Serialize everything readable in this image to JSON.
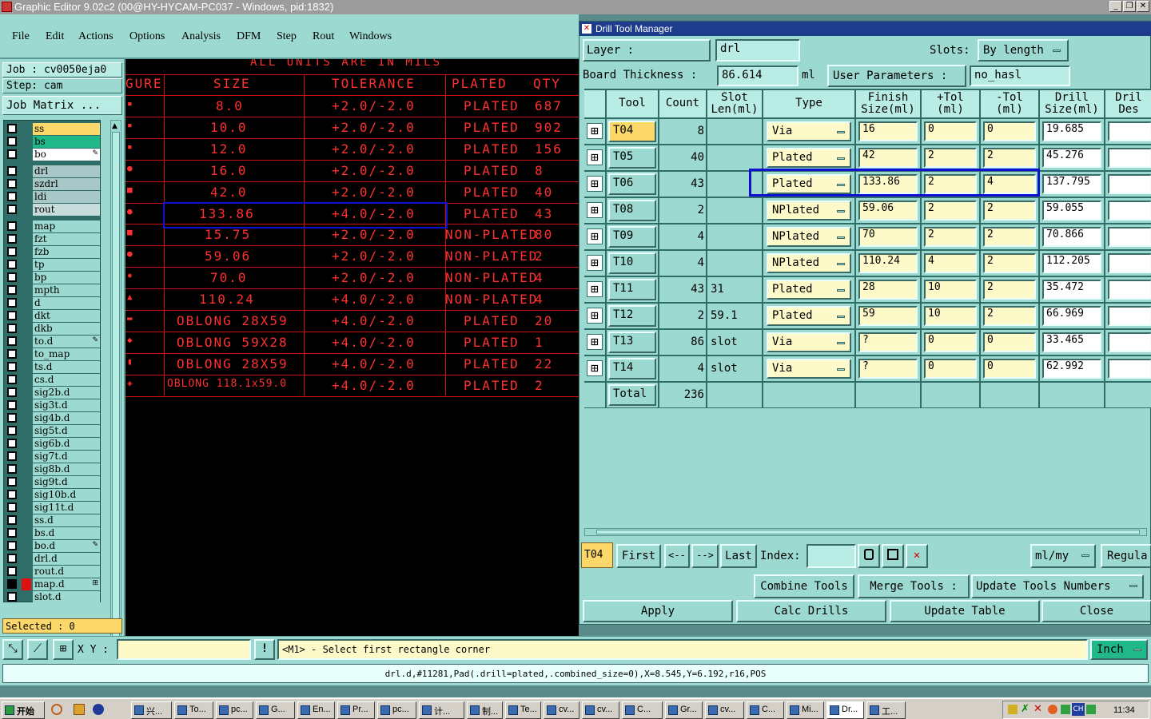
{
  "titlebar": {
    "title": "Graphic Editor 9.02c2 (00@HY-HYCAM-PC037 - Windows, pid:1832)"
  },
  "menu": [
    "File",
    "Edit",
    "Actions",
    "Options",
    "Analysis",
    "DFM",
    "Step",
    "Rout",
    "Windows"
  ],
  "left": {
    "job": "Job : cv0050eja0",
    "step": "Step: cam",
    "job_matrix": "Job Matrix ...",
    "selected": "Selected : 0",
    "layers": [
      {
        "name": "ss",
        "color": "#fcd86a",
        "tag": ""
      },
      {
        "name": "bs",
        "color": "#20b888",
        "tag": ""
      },
      {
        "name": "bo",
        "color": "#ffffff",
        "tag": "✎"
      },
      {
        "name": "drl",
        "color": "#a8c8c8",
        "tag": ""
      },
      {
        "name": "szdrl",
        "color": "#a8c8c8",
        "tag": ""
      },
      {
        "name": "ldi",
        "color": "#a8c8c8",
        "tag": ""
      },
      {
        "name": "rout",
        "color": "#c8dcdc",
        "tag": ""
      },
      {
        "name": "map",
        "color": "#9cd9d0",
        "tag": ""
      },
      {
        "name": "fzt",
        "color": "#9cd9d0",
        "tag": ""
      },
      {
        "name": "fzb",
        "color": "#9cd9d0",
        "tag": ""
      },
      {
        "name": "tp",
        "color": "#9cd9d0",
        "tag": ""
      },
      {
        "name": "bp",
        "color": "#9cd9d0",
        "tag": ""
      },
      {
        "name": "mpth",
        "color": "#9cd9d0",
        "tag": ""
      },
      {
        "name": "d",
        "color": "#9cd9d0",
        "tag": ""
      },
      {
        "name": "dkt",
        "color": "#9cd9d0",
        "tag": ""
      },
      {
        "name": "dkb",
        "color": "#9cd9d0",
        "tag": ""
      },
      {
        "name": "to.d",
        "color": "#9cd9d0",
        "tag": "✎"
      },
      {
        "name": "to_map",
        "color": "#9cd9d0",
        "tag": ""
      },
      {
        "name": "ts.d",
        "color": "#9cd9d0",
        "tag": ""
      },
      {
        "name": "cs.d",
        "color": "#9cd9d0",
        "tag": ""
      },
      {
        "name": "sig2b.d",
        "color": "#9cd9d0",
        "tag": ""
      },
      {
        "name": "sig3t.d",
        "color": "#9cd9d0",
        "tag": ""
      },
      {
        "name": "sig4b.d",
        "color": "#9cd9d0",
        "tag": ""
      },
      {
        "name": "sig5t.d",
        "color": "#9cd9d0",
        "tag": ""
      },
      {
        "name": "sig6b.d",
        "color": "#9cd9d0",
        "tag": ""
      },
      {
        "name": "sig7t.d",
        "color": "#9cd9d0",
        "tag": ""
      },
      {
        "name": "sig8b.d",
        "color": "#9cd9d0",
        "tag": ""
      },
      {
        "name": "sig9t.d",
        "color": "#9cd9d0",
        "tag": ""
      },
      {
        "name": "sig10b.d",
        "color": "#9cd9d0",
        "tag": ""
      },
      {
        "name": "sig11t.d",
        "color": "#9cd9d0",
        "tag": ""
      },
      {
        "name": "ss.d",
        "color": "#9cd9d0",
        "tag": ""
      },
      {
        "name": "bs.d",
        "color": "#9cd9d0",
        "tag": ""
      },
      {
        "name": "bo.d",
        "color": "#9cd9d0",
        "tag": "✎"
      },
      {
        "name": "drl.d",
        "color": "#9cd9d0",
        "tag": ""
      },
      {
        "name": "rout.d",
        "color": "#9cd9d0",
        "tag": ""
      },
      {
        "name": "map.d",
        "color": "#9cd9d0",
        "tag": "⊞"
      },
      {
        "name": "slot.d",
        "color": "#9cd9d0",
        "tag": ""
      }
    ]
  },
  "canvas": {
    "banner": "ALL UNITS ARE IN MILS",
    "headers": [
      "GURE",
      "SIZE",
      "TOLERANCE",
      "PLATED",
      "QTY"
    ],
    "rows": [
      {
        "size": "8.0",
        "tol": "+2.0/-2.0",
        "plated": "PLATED",
        "qty": "687",
        "sym": "▪"
      },
      {
        "size": "10.0",
        "tol": "+2.0/-2.0",
        "plated": "PLATED",
        "qty": "902",
        "sym": "▪"
      },
      {
        "size": "12.0",
        "tol": "+2.0/-2.0",
        "plated": "PLATED",
        "qty": "156",
        "sym": "▪"
      },
      {
        "size": "16.0",
        "tol": "+2.0/-2.0",
        "plated": "PLATED",
        "qty": "8",
        "sym": "●"
      },
      {
        "size": "42.0",
        "tol": "+2.0/-2.0",
        "plated": "PLATED",
        "qty": "40",
        "sym": "■"
      },
      {
        "size": "133.86",
        "tol": "+4.0/-2.0",
        "plated": "PLATED",
        "qty": "43",
        "sym": "●"
      },
      {
        "size": "15.75",
        "tol": "+2.0/-2.0",
        "plated": "NON-PLATED",
        "qty": "80",
        "sym": "■"
      },
      {
        "size": "59.06",
        "tol": "+2.0/-2.0",
        "plated": "NON-PLATED",
        "qty": "2",
        "sym": "●"
      },
      {
        "size": "70.0",
        "tol": "+2.0/-2.0",
        "plated": "NON-PLATED",
        "qty": "4",
        "sym": "✹"
      },
      {
        "size": "110.24",
        "tol": "+4.0/-2.0",
        "plated": "NON-PLATED",
        "qty": "4",
        "sym": "▲"
      },
      {
        "size": "OBLONG 28X59",
        "tol": "+4.0/-2.0",
        "plated": "PLATED",
        "qty": "20",
        "sym": "▬"
      },
      {
        "size": "OBLONG 59X28",
        "tol": "+4.0/-2.0",
        "plated": "PLATED",
        "qty": "1",
        "sym": "◆"
      },
      {
        "size": "OBLONG 28X59",
        "tol": "+4.0/-2.0",
        "plated": "PLATED",
        "qty": "22",
        "sym": "▮"
      },
      {
        "size": "OBLONG 118.1x59.0",
        "tol": "+4.0/-2.0",
        "plated": "PLATED",
        "qty": "2",
        "sym": "◈"
      }
    ]
  },
  "dialog": {
    "title": "Drill Tool Manager",
    "layer_label": "Layer          :",
    "layer_value": "drl",
    "slots_label": "Slots:",
    "slots_value": "By length",
    "board_thickness_label": "Board Thickness :",
    "board_thickness_value": "86.614",
    "board_thickness_unit": "ml",
    "user_params_label": "User Parameters :",
    "user_params_value": "no_hasl",
    "columns": [
      "Tool",
      "Count",
      "Slot Len(ml)",
      "Type",
      "Finish Size(ml)",
      "+Tol (ml)",
      "-Tol (ml)",
      "Drill Size(ml)",
      "Dril Des"
    ],
    "tools": [
      {
        "tool": "T04",
        "count": "8",
        "slot": "",
        "type": "Via",
        "finish": "16",
        "ptol": "0",
        "mtol": "0",
        "drill": "19.685"
      },
      {
        "tool": "T05",
        "count": "40",
        "slot": "",
        "type": "Plated",
        "finish": "42",
        "ptol": "2",
        "mtol": "2",
        "drill": "45.276"
      },
      {
        "tool": "T06",
        "count": "43",
        "slot": "",
        "type": "Plated",
        "finish": "133.86",
        "ptol": "2",
        "mtol": "4",
        "drill": "137.795"
      },
      {
        "tool": "T08",
        "count": "2",
        "slot": "",
        "type": "NPlated",
        "finish": "59.06",
        "ptol": "2",
        "mtol": "2",
        "drill": "59.055"
      },
      {
        "tool": "T09",
        "count": "4",
        "slot": "",
        "type": "NPlated",
        "finish": "70",
        "ptol": "2",
        "mtol": "2",
        "drill": "70.866"
      },
      {
        "tool": "T10",
        "count": "4",
        "slot": "",
        "type": "NPlated",
        "finish": "110.24",
        "ptol": "4",
        "mtol": "2",
        "drill": "112.205"
      },
      {
        "tool": "T11",
        "count": "43",
        "slot": "31",
        "type": "Plated",
        "finish": "28",
        "ptol": "10",
        "mtol": "2",
        "drill": "35.472"
      },
      {
        "tool": "T12",
        "count": "2",
        "slot": "59.1",
        "type": "Plated",
        "finish": "59",
        "ptol": "10",
        "mtol": "2",
        "drill": "66.969"
      },
      {
        "tool": "T13",
        "count": "86",
        "slot": "slot",
        "type": "Via",
        "finish": "?",
        "ptol": "0",
        "mtol": "0",
        "drill": "33.465"
      },
      {
        "tool": "T14",
        "count": "4",
        "slot": "slot",
        "type": "Via",
        "finish": "?",
        "ptol": "0",
        "mtol": "0",
        "drill": "62.992"
      }
    ],
    "total_label": "Total",
    "total_count": "236",
    "current_tool": "T04",
    "nav": {
      "first": "First",
      "prev": "<--",
      "next": "-->",
      "last": "Last",
      "index_label": "Index:"
    },
    "units_value": "ml/my",
    "regula": "Regula",
    "combine_tools": "Combine Tools",
    "merge_tools": "Merge Tools :",
    "update_tools_numbers": "Update Tools Numbers",
    "apply": "Apply",
    "calc_drills": "Calc Drills",
    "update_table": "Update Table",
    "close": "Close"
  },
  "cmd": {
    "xy_label": "X Y :",
    "prompt": "<M1> - Select first rectangle corner",
    "units": "Inch",
    "status": "drl.d,#11281,Pad(.drill=plated,.combined_size=0),X=8.545,Y=6.192,r16,POS"
  },
  "taskbar": {
    "start": "开始",
    "items": [
      "兴...",
      "To...",
      "pc...",
      "G...",
      "En...",
      "Pr...",
      "pc...",
      "计...",
      "制...",
      "Te...",
      "cv...",
      "cv...",
      "C...",
      "Gr...",
      "cv...",
      "C...",
      "Mi...",
      "Dr...",
      "工..."
    ],
    "clock": "11:34",
    "ime": "CH"
  }
}
